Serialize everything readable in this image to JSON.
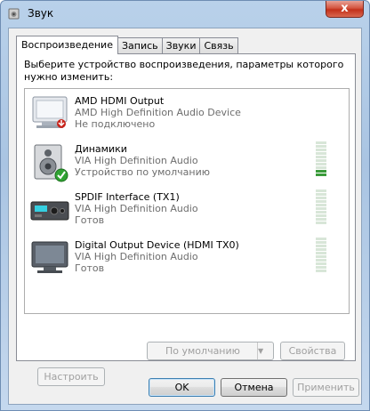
{
  "window": {
    "title": "Звук",
    "close_glyph": "x"
  },
  "tabs": [
    {
      "label": "Воспроизведение"
    },
    {
      "label": "Запись"
    },
    {
      "label": "Звуки"
    },
    {
      "label": "Связь"
    }
  ],
  "instruction": "Выберите устройство воспроизведения, параметры которого нужно изменить:",
  "devices": [
    {
      "name": "AMD HDMI Output",
      "driver": "AMD High Definition Audio Device",
      "status": "Не подключено",
      "icon": "monitor-disconnected-icon",
      "level": 0
    },
    {
      "name": "Динамики",
      "driver": "VIA High Definition Audio",
      "status": "Устройство по умолчанию",
      "icon": "speaker-default-icon",
      "level": 0.2
    },
    {
      "name": "SPDIF Interface (TX1)",
      "driver": "VIA High Definition Audio",
      "status": "Готов",
      "icon": "spdif-receiver-icon",
      "level": 0
    },
    {
      "name": "Digital Output Device (HDMI TX0)",
      "driver": "VIA High Definition Audio",
      "status": "Готов",
      "icon": "monitor-icon",
      "level": 0
    }
  ],
  "buttons": {
    "configure": "Настроить",
    "set_default": "По умолчанию",
    "properties": "Свойства",
    "ok": "OK",
    "cancel": "Отмена",
    "apply": "Применить"
  }
}
